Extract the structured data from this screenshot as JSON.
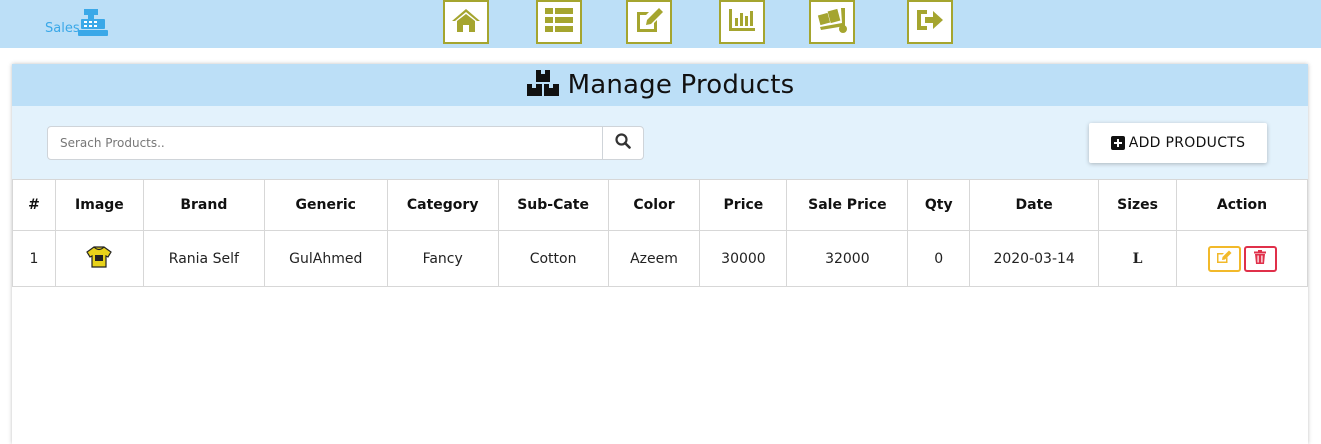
{
  "header": {
    "brand_text": "Sales",
    "brand_icon": "cash-register-icon",
    "nav": [
      {
        "icon": "home-icon"
      },
      {
        "icon": "list-icon"
      },
      {
        "icon": "edit-icon"
      },
      {
        "icon": "chart-icon"
      },
      {
        "icon": "dolly-icon"
      },
      {
        "icon": "sign-out-icon"
      }
    ],
    "bg_color": "#bcdff7",
    "nav_border_color": "#a5a52f"
  },
  "panel": {
    "title": "Manage Products",
    "title_icon": "boxes-icon"
  },
  "search": {
    "placeholder": "Serach Products..",
    "value": ""
  },
  "add_button": {
    "label": "ADD PRODUCTS"
  },
  "table": {
    "headers": [
      "#",
      "Image",
      "Brand",
      "Generic",
      "Category",
      "Sub-Cate",
      "Color",
      "Price",
      "Sale Price",
      "Qty",
      "Date",
      "Sizes",
      "Action"
    ],
    "rows": [
      {
        "num": "1",
        "image": "product-thumbnail",
        "brand": "Rania Self",
        "generic": "GulAhmed",
        "category": "Fancy",
        "sub_cate": "Cotton",
        "color": "Azeem",
        "price": "30000",
        "sale_price": "32000",
        "qty": "0",
        "date": "2020-03-14",
        "sizes": "L"
      }
    ]
  },
  "colors": {
    "price": "#23239b",
    "sale_price": "#3fb33f",
    "edit": "#f2b92a",
    "delete": "#e0304a",
    "toolbar_bg": "#e3f2fc"
  }
}
